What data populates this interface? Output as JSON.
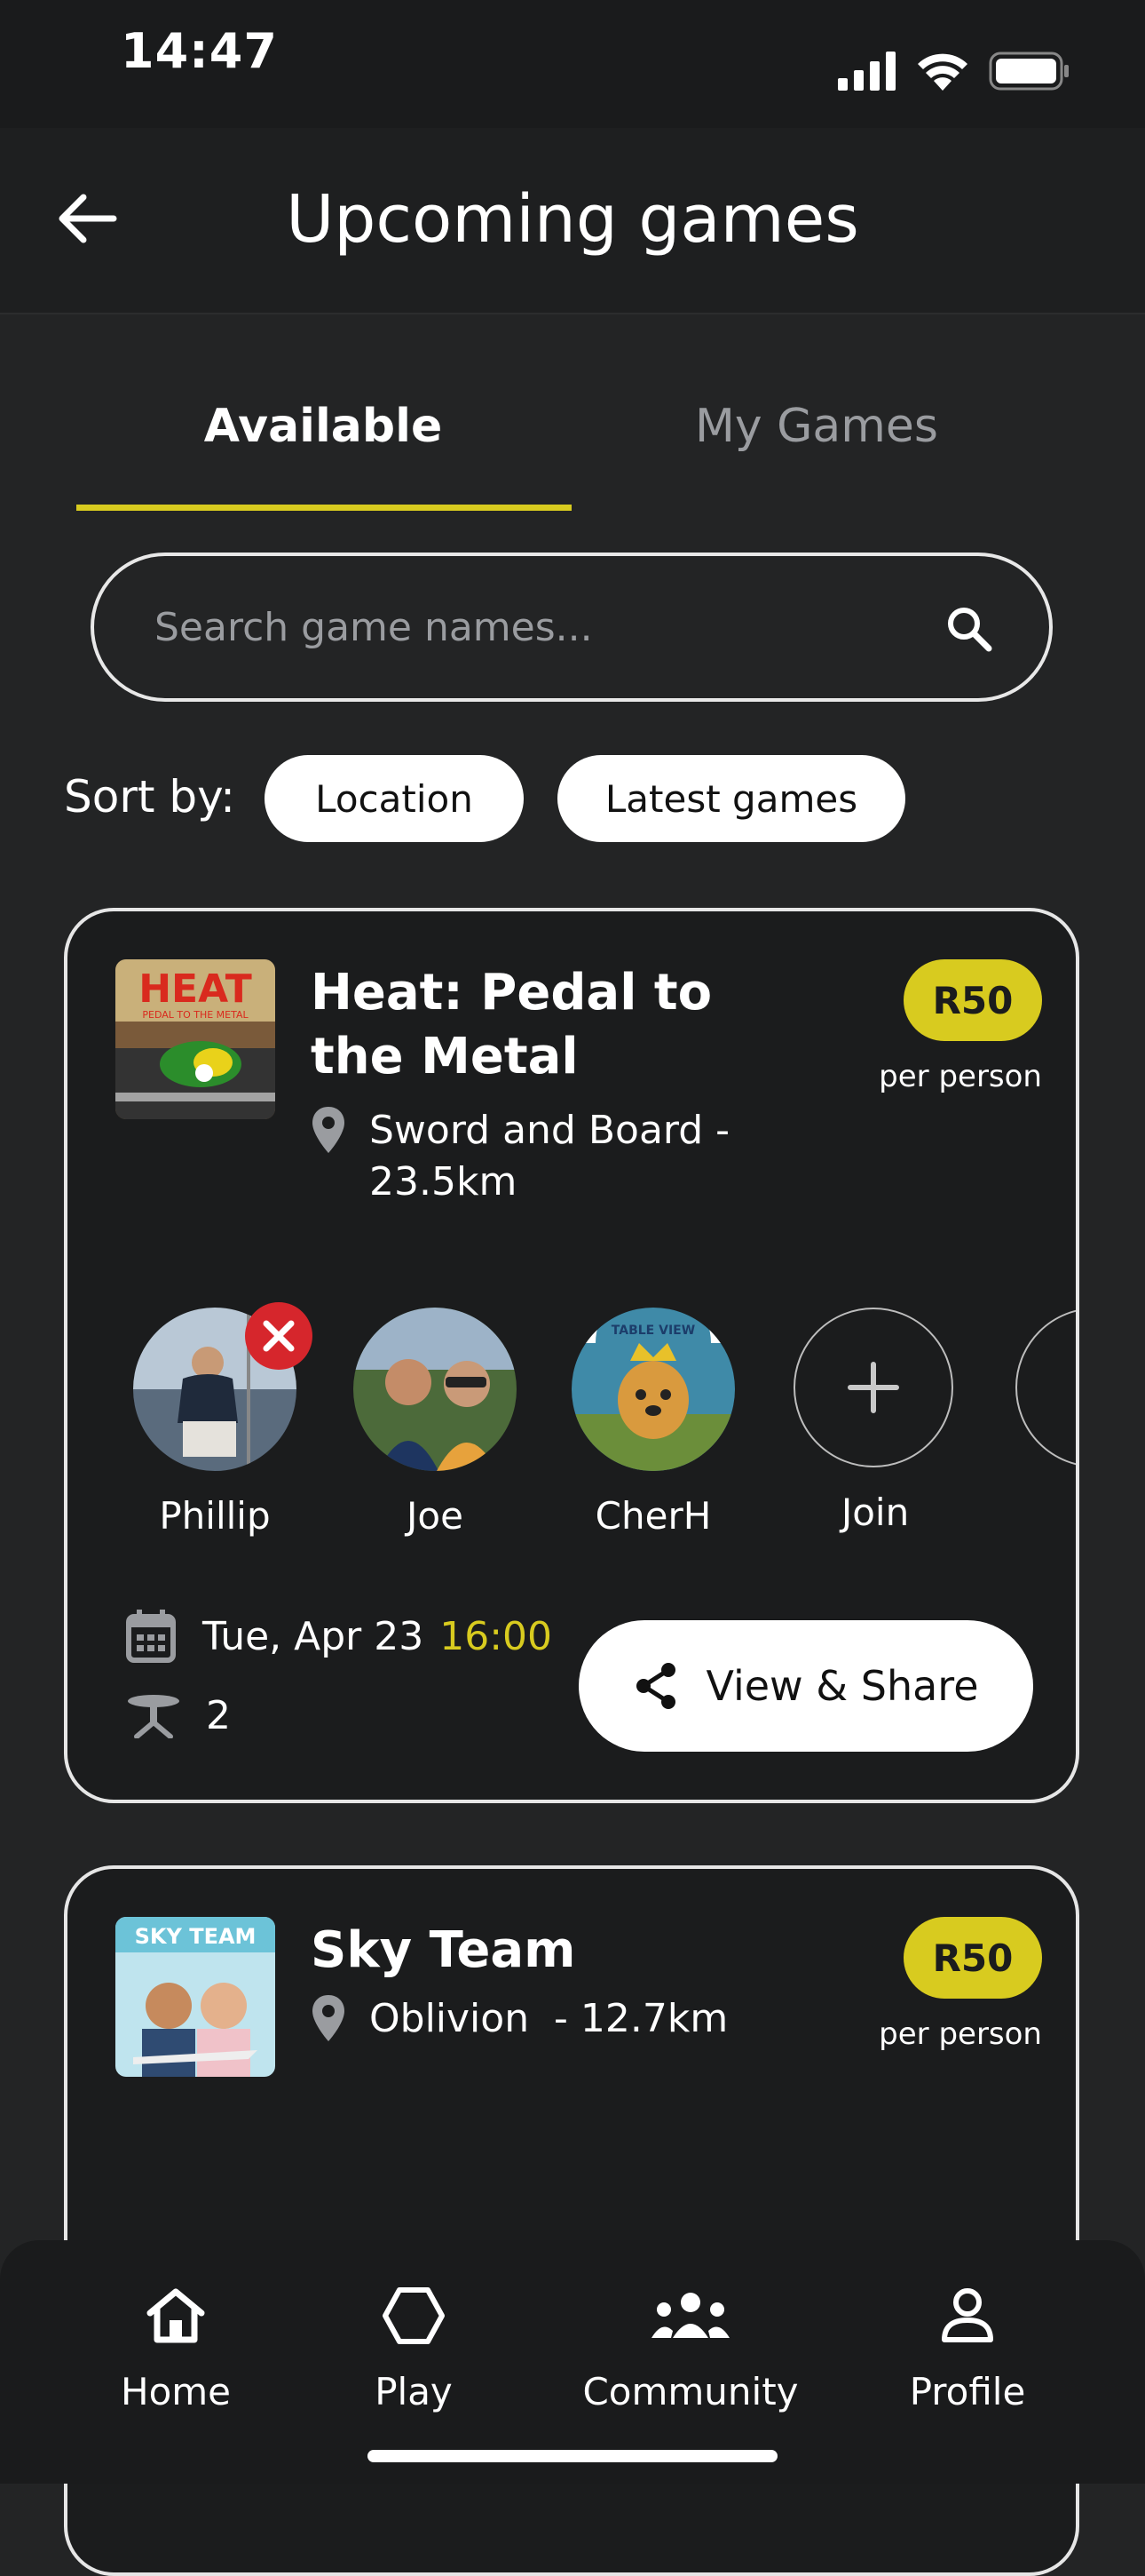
{
  "status_bar": {
    "time": "14:47"
  },
  "header": {
    "title": "Upcoming games"
  },
  "tabs": [
    {
      "label": "Available",
      "active": true
    },
    {
      "label": "My Games",
      "active": false
    }
  ],
  "search": {
    "placeholder": "Search game names..."
  },
  "sort": {
    "label": "Sort by:",
    "options": [
      "Location",
      "Latest games"
    ]
  },
  "games": [
    {
      "title": "Heat: Pedal to the Metal",
      "cover_text": "HEAT",
      "cover_subtext": "PEDAL TO THE METAL",
      "location": "Sword and Board -\n23.5km",
      "price": "R50",
      "price_unit": "per person",
      "players": [
        "Phillip",
        "Joe",
        "CherH"
      ],
      "join_label": "Join",
      "date": "Tue, Apr 23",
      "time": "16:00",
      "tables": "2",
      "share_label": "View & Share"
    },
    {
      "title": "Sky Team",
      "cover_text": "SKY TEAM",
      "location": "Oblivion  - 12.7km",
      "price": "R50",
      "price_unit": "per person"
    }
  ],
  "avatar_badge": "TABLE VIEW",
  "nav": [
    {
      "label": "Home",
      "icon": "home-icon"
    },
    {
      "label": "Play",
      "icon": "hexagon-icon"
    },
    {
      "label": "Community",
      "icon": "community-icon"
    },
    {
      "label": "Profile",
      "icon": "profile-icon"
    }
  ],
  "colors": {
    "accent": "#d8cb1f",
    "background": "#232425",
    "card": "#1b1c1d",
    "danger": "#d6262c"
  }
}
